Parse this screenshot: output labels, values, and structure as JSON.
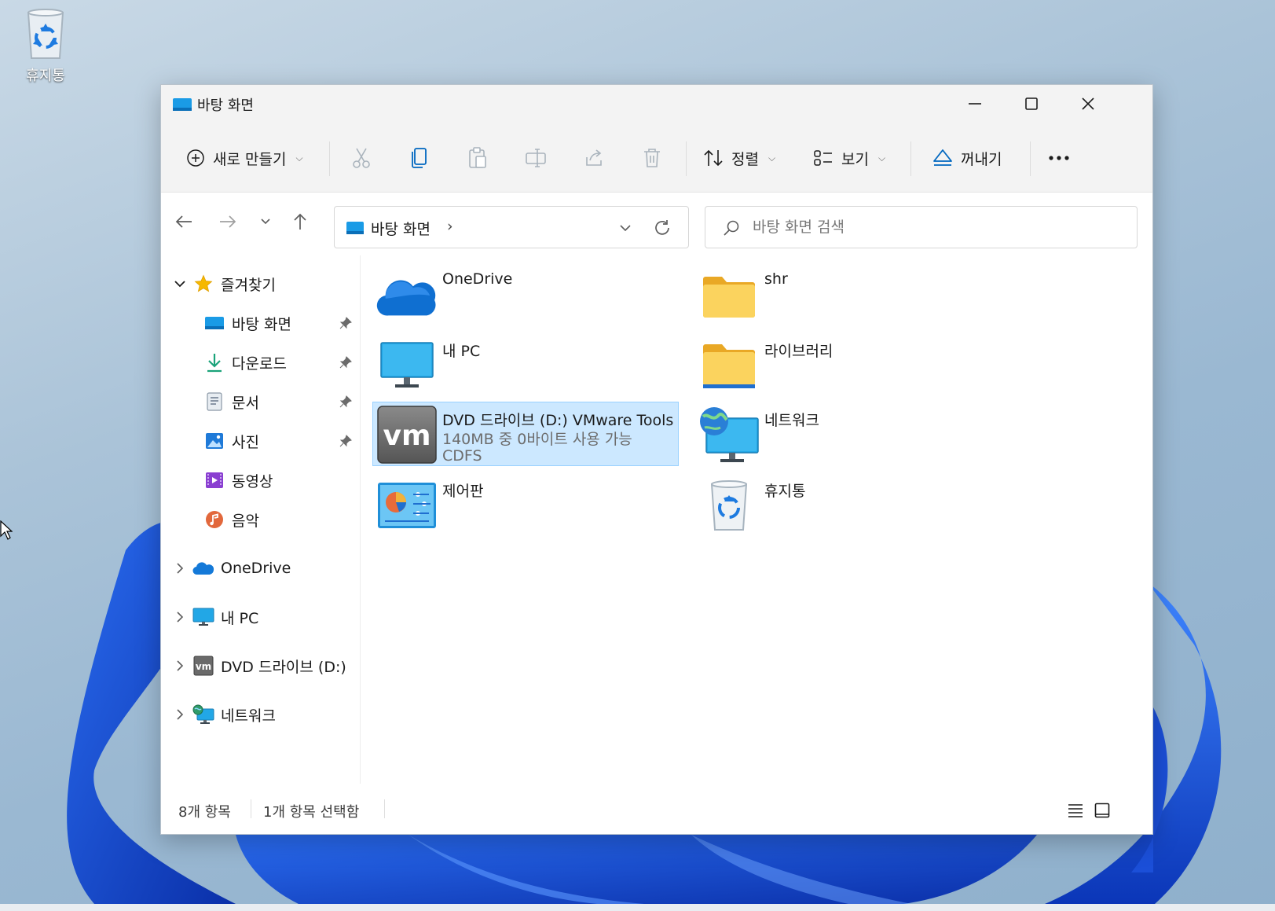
{
  "desktop": {
    "recycle_bin_label": "휴지통",
    "wallpaper_accent": "#1a55d6"
  },
  "window": {
    "title": "바탕 화면",
    "controls": {
      "minimize": "minimize-icon",
      "maximize": "maximize-icon",
      "close": "close-icon"
    }
  },
  "commandbar": {
    "new_label": "새로 만들기",
    "sort_label": "정렬",
    "view_label": "보기",
    "eject_label": "꺼내기",
    "icons": [
      "cut-icon",
      "copy-icon",
      "paste-icon",
      "rename-icon",
      "share-icon",
      "delete-icon",
      "more-icon"
    ]
  },
  "address": {
    "location": "바탕 화면",
    "separator": "›",
    "search_placeholder": "바탕 화면 검색"
  },
  "sidebar": {
    "quick_access": {
      "label": "즐겨찾기",
      "items": [
        {
          "label": "바탕 화면",
          "icon": "desktop-icon",
          "pinned": true
        },
        {
          "label": "다운로드",
          "icon": "download-icon",
          "pinned": true
        },
        {
          "label": "문서",
          "icon": "document-icon",
          "pinned": true
        },
        {
          "label": "사진",
          "icon": "pictures-icon",
          "pinned": true
        },
        {
          "label": "동영상",
          "icon": "videos-icon",
          "pinned": false
        },
        {
          "label": "음악",
          "icon": "music-icon",
          "pinned": false
        }
      ]
    },
    "roots": [
      {
        "label": "OneDrive",
        "icon": "onedrive-icon"
      },
      {
        "label": "내 PC",
        "icon": "pc-icon"
      },
      {
        "label": "DVD 드라이브 (D:)",
        "icon": "vmware-icon"
      },
      {
        "label": "네트워크",
        "icon": "network-icon"
      }
    ]
  },
  "items": [
    {
      "name": "OneDrive",
      "icon": "onedrive-icon"
    },
    {
      "name": "shr",
      "icon": "folder-icon"
    },
    {
      "name": "내 PC",
      "icon": "pc-icon"
    },
    {
      "name": "라이브러리",
      "icon": "library-folder-icon"
    },
    {
      "name": "DVD 드라이브 (D:) VMware Tools",
      "icon": "vmware-icon",
      "selected": true,
      "sub1": "140MB 중 0바이트 사용 가능",
      "sub2": "CDFS"
    },
    {
      "name": "네트워크",
      "icon": "network-icon"
    },
    {
      "name": "제어판",
      "icon": "control-panel-icon"
    },
    {
      "name": "휴지통",
      "icon": "recycle-bin-icon"
    }
  ],
  "status": {
    "item_count": "8개 항목",
    "selection": "1개 항목 선택함"
  },
  "colors": {
    "selection_bg": "#cce8ff",
    "selection_border": "#99d1ff",
    "folder_yellow": "#f9c846",
    "accent_blue": "#0067c0"
  }
}
